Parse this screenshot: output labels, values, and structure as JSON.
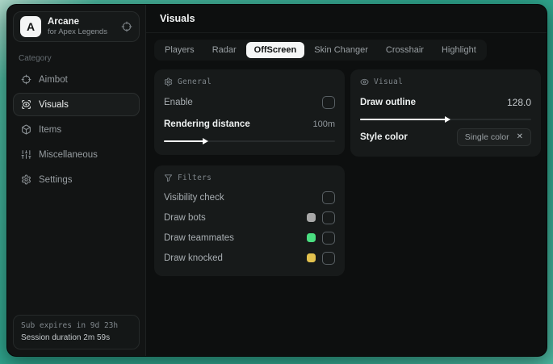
{
  "window": {
    "brand": {
      "logo_letter": "A",
      "name": "Arcane",
      "subtitle": "for Apex Legends"
    },
    "sidebar": {
      "category_label": "Category",
      "items": [
        {
          "label": "Aimbot"
        },
        {
          "label": "Visuals"
        },
        {
          "label": "Items"
        },
        {
          "label": "Miscellaneous"
        },
        {
          "label": "Settings"
        }
      ],
      "footer": {
        "expiry": "Sub expires in 9d 23h",
        "session": "Session duration 2m 59s"
      }
    },
    "header": {
      "title": "Visuals"
    },
    "tabs": [
      {
        "label": "Players"
      },
      {
        "label": "Radar"
      },
      {
        "label": "OffScreen"
      },
      {
        "label": "Skin Changer"
      },
      {
        "label": "Crosshair"
      },
      {
        "label": "Highlight"
      }
    ],
    "selected_tab": "OffScreen",
    "cards": {
      "general": {
        "title": "General",
        "enable_label": "Enable",
        "rendering_label": "Rendering distance",
        "rendering_value": "100m",
        "rendering_pct": 23
      },
      "filters": {
        "title": "Filters",
        "rows": [
          {
            "label": "Visibility check"
          },
          {
            "label": "Draw bots",
            "swatch": "#a8a8a8"
          },
          {
            "label": "Draw teammates",
            "swatch": "#4ade80"
          },
          {
            "label": "Draw knocked",
            "swatch": "#e2c14e"
          }
        ]
      },
      "visual": {
        "title": "Visual",
        "outline_label": "Draw outline",
        "outline_value": "128.0",
        "outline_pct": 50,
        "style_label": "Style color",
        "style_value": "Single color",
        "clear_icon": "✕"
      }
    },
    "colors": {
      "accent_teal": "#2da18a",
      "selected_tab_bg": "#f5f6f6",
      "panel_bg": "#0d0f0f"
    }
  }
}
